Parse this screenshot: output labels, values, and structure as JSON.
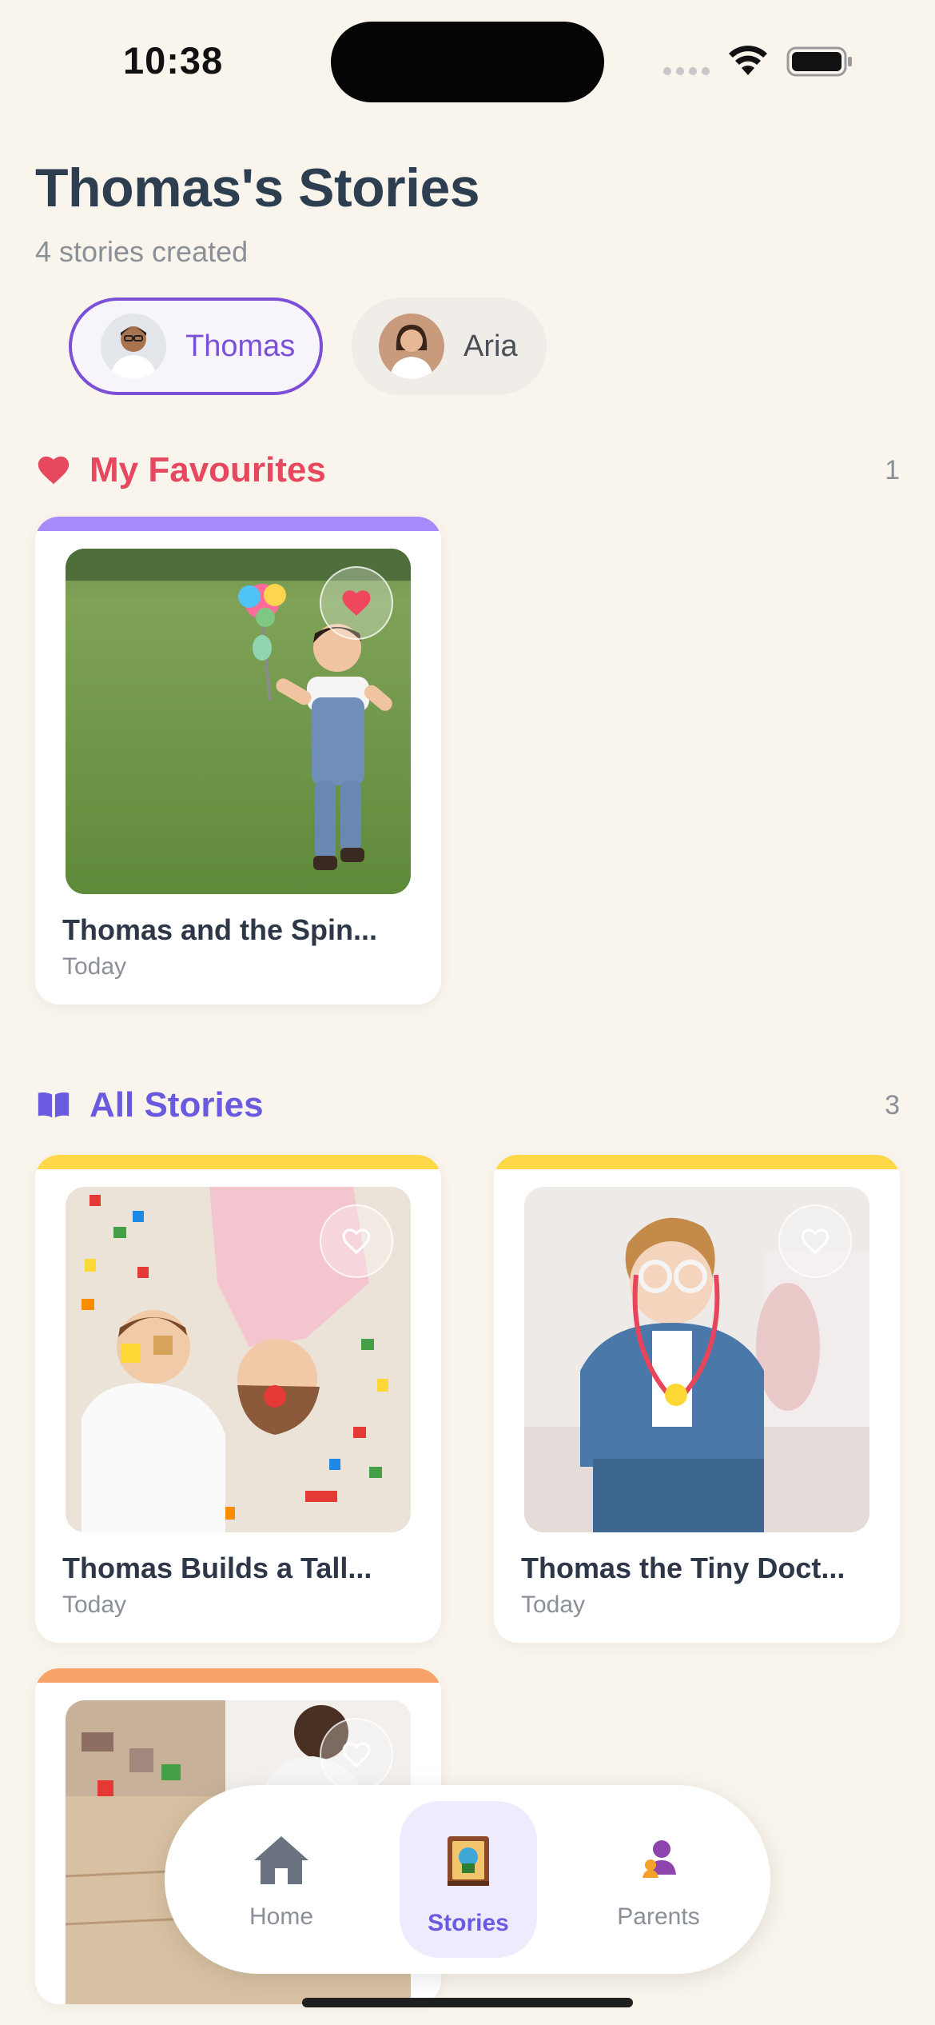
{
  "status_bar": {
    "time": "10:38"
  },
  "header": {
    "title": "Thomas's Stories",
    "subtitle": "4 stories created"
  },
  "profiles": [
    {
      "name": "Thomas",
      "selected": true,
      "avatar": "boy-avatar"
    },
    {
      "name": "Aria",
      "selected": false,
      "avatar": "girl-avatar"
    }
  ],
  "favourites": {
    "title": "My Favourites",
    "count": "1",
    "icon": "heart-icon",
    "color": "#e5485f",
    "stories": [
      {
        "title": "Thomas and the Spin...",
        "date": "Today",
        "accent": "#a78bfa",
        "favourited": true,
        "image": "boy-with-pinwheel-on-grass"
      }
    ]
  },
  "all_stories": {
    "title": "All Stories",
    "count": "3",
    "icon": "book-icon",
    "color": "#6a5ae0",
    "stories": [
      {
        "title": "Thomas Builds a Tall...",
        "date": "Today",
        "accent": "#ffd84a",
        "favourited": false,
        "image": "kids-playing-with-blocks"
      },
      {
        "title": "Thomas the Tiny Doct...",
        "date": "Today",
        "accent": "#ffd84a",
        "favourited": false,
        "image": "toddler-with-stethoscope"
      },
      {
        "title": "",
        "date": "",
        "accent": "#f7a36a",
        "favourited": false,
        "image": "child-playing-with-toy-train"
      }
    ]
  },
  "bottom_nav": {
    "items": [
      {
        "label": "Home",
        "icon": "home-icon",
        "active": false
      },
      {
        "label": "Stories",
        "icon": "storybook-icon",
        "active": true
      },
      {
        "label": "Parents",
        "icon": "parents-icon",
        "active": false
      }
    ]
  }
}
